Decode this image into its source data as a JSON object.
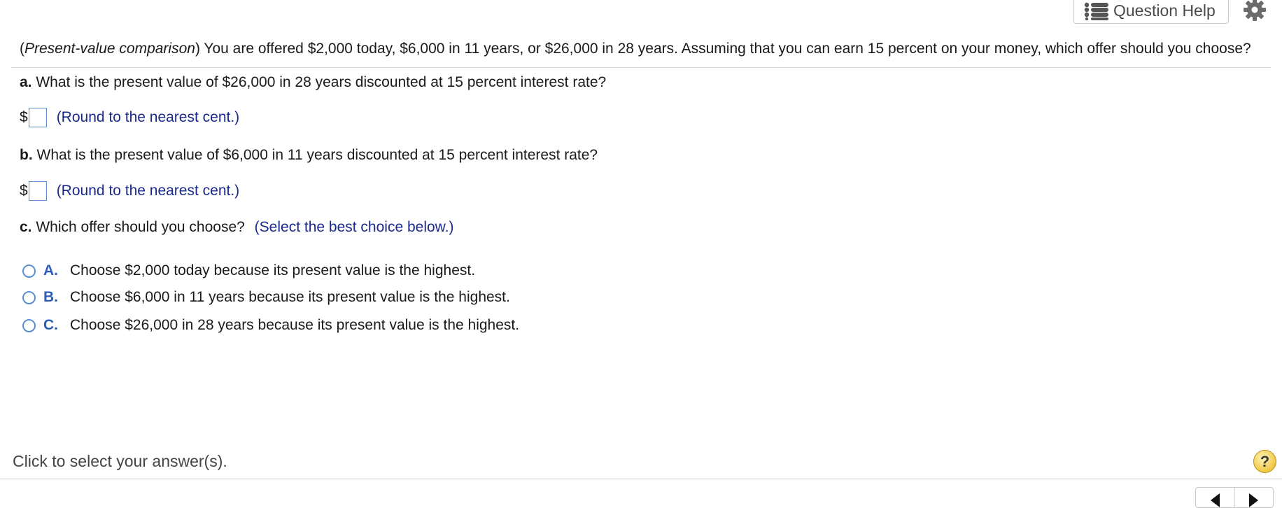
{
  "toolbar": {
    "question_help_label": "Question Help",
    "list_icon": "list-icon",
    "settings_icon": "gear-icon"
  },
  "question": {
    "stem_prefix_open": "(",
    "stem_topic": "Present-value comparison",
    "stem_text": ") You are offered $2,000 today, $6,000 in 11 years, or $26,000 in 28 years. Assuming that you can earn 15 percent on your money, which offer should you choose?"
  },
  "parts": {
    "a": {
      "label": "a.",
      "question": "What is the present value of $26,000 in 28 years discounted at 15 percent interest rate?",
      "currency": "$",
      "value": "",
      "note": "(Round to the nearest cent.)"
    },
    "b": {
      "label": "b.",
      "question": "What is the present value of $6,000 in 11 years discounted at 15 percent interest rate?",
      "currency": "$",
      "value": "",
      "note": "(Round to the nearest cent.)"
    },
    "c": {
      "label": "c.",
      "question": "Which offer should you choose?",
      "instruction": "(Select the best choice below.)"
    }
  },
  "choices": [
    {
      "letter": "A.",
      "text": "Choose $2,000 today because its present value is the highest.",
      "selected": false
    },
    {
      "letter": "B.",
      "text": "Choose $6,000 in 11 years because its present value is the highest.",
      "selected": false
    },
    {
      "letter": "C.",
      "text": "Choose $26,000 in 28 years because its present value is the highest.",
      "selected": false
    }
  ],
  "footer": {
    "status": "Click to select your answer(s).",
    "help_symbol": "?"
  },
  "colors": {
    "accent_blue": "#2f5db7",
    "instruction_navy": "#1a2a8c",
    "input_border": "#5b8fd0",
    "help_yellow": "#f0c846"
  }
}
